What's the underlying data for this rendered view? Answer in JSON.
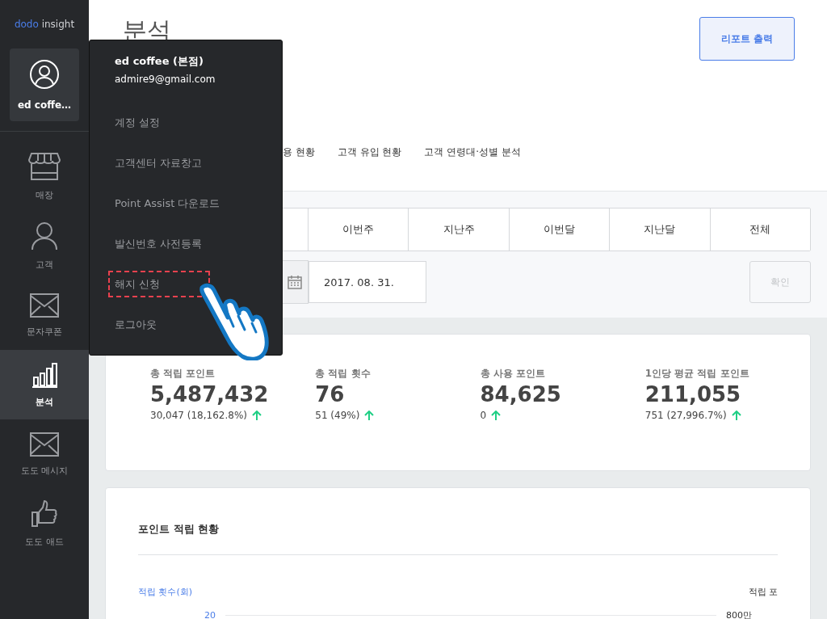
{
  "brand": {
    "first": "dodo",
    "second": "insight"
  },
  "profile": {
    "name": "ed coffe…"
  },
  "sidebar": {
    "items": [
      {
        "kind": "store",
        "label": "매장",
        "selected": false
      },
      {
        "kind": "person",
        "label": "고객",
        "selected": false
      },
      {
        "kind": "mail",
        "label": "문자쿠폰",
        "selected": false
      },
      {
        "kind": "chart",
        "label": "분석",
        "selected": true
      },
      {
        "kind": "mail",
        "label": "도도 메시지",
        "selected": false
      },
      {
        "kind": "thumb",
        "label": "도도 애드",
        "selected": false
      }
    ]
  },
  "page_title": "분석",
  "report_button": "리포트 출력",
  "tabs": [
    {
      "label": "용 현황",
      "selected": false
    },
    {
      "label": "고객 유입 현황",
      "selected": false
    },
    {
      "label": "고객 연령대·성별 분석",
      "selected": false
    }
  ],
  "periods": [
    "이번주",
    "지난주",
    "이번달",
    "지난달",
    "전체"
  ],
  "date_to": "2017. 08. 31.",
  "confirm_button": {
    "label": "확인",
    "disabled": true
  },
  "stats": [
    {
      "label": "총 적립 포인트",
      "value": "5,487,432",
      "change": "30,047 (18,162.8%)",
      "kind": "up"
    },
    {
      "label": "총 적립 횟수",
      "value": "76",
      "change": "51 (49%)",
      "kind": "up"
    },
    {
      "label": "총 사용 포인트",
      "value": "84,625",
      "change": "0",
      "kind": "up"
    },
    {
      "label": "1인당 평균 적립 포인트",
      "value": "211,055",
      "change": "751 (27,996.7%)",
      "kind": "up"
    }
  ],
  "chart_panel": {
    "title": "포인트 적립 현황",
    "left_axis": "적립 횟수(회)",
    "right_axis": "적립 포",
    "left_tick": "20",
    "right_tick": "800만"
  },
  "account_menu": {
    "name": "ed coffee (본점)",
    "email": "admire9@gmail.com",
    "items": [
      {
        "label": "계정 설정",
        "highlighted": false
      },
      {
        "label": "고객센터 자료창고",
        "highlighted": false
      },
      {
        "label": "Point Assist 다운로드",
        "highlighted": false
      },
      {
        "label": "발신번호 사전등록",
        "highlighted": false
      },
      {
        "label": "해지 신청",
        "highlighted": true
      },
      {
        "label": "로그아웃",
        "highlighted": false
      }
    ]
  }
}
